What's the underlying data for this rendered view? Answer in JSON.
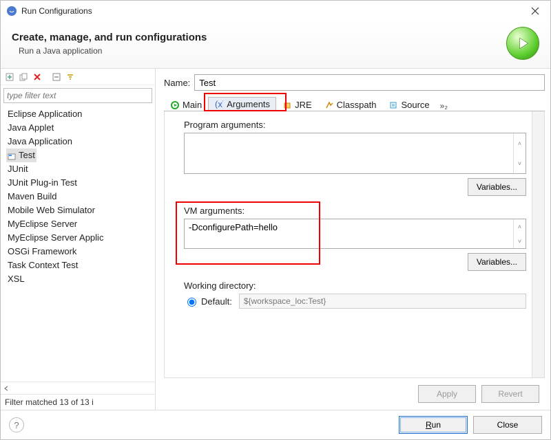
{
  "window": {
    "title": "Run Configurations"
  },
  "header": {
    "heading": "Create, manage, and run configurations",
    "sub": "Run a Java application"
  },
  "left": {
    "filter_placeholder": "type filter text",
    "items": [
      "Eclipse Application",
      "Java Applet",
      "Java Application",
      "Test",
      "JUnit",
      "JUnit Plug-in Test",
      "Maven Build",
      "Mobile Web Simulator",
      "MyEclipse Server",
      "MyEclipse Server Applic",
      "OSGi Framework",
      "Task Context Test",
      "XSL"
    ],
    "selected_index": 3,
    "status": "Filter matched 13 of 13 i"
  },
  "right": {
    "name_label": "Name:",
    "name_value": "Test",
    "tabs": {
      "items": [
        "Main",
        "Arguments",
        "JRE",
        "Classpath",
        "Source"
      ],
      "active_index": 1,
      "more": "»₂"
    },
    "program_args": {
      "label": "Program arguments:",
      "value": "",
      "variables_btn": "Variables..."
    },
    "vm_args": {
      "label": "VM arguments:",
      "value": "-DconfigurePath=hello",
      "variables_btn": "Variables..."
    },
    "working_dir": {
      "label": "Working directory:",
      "default_label": "Default:",
      "default_value": "${workspace_loc:Test}"
    },
    "apply": "Apply",
    "revert": "Revert"
  },
  "footer": {
    "run": "Run",
    "close": "Close"
  }
}
